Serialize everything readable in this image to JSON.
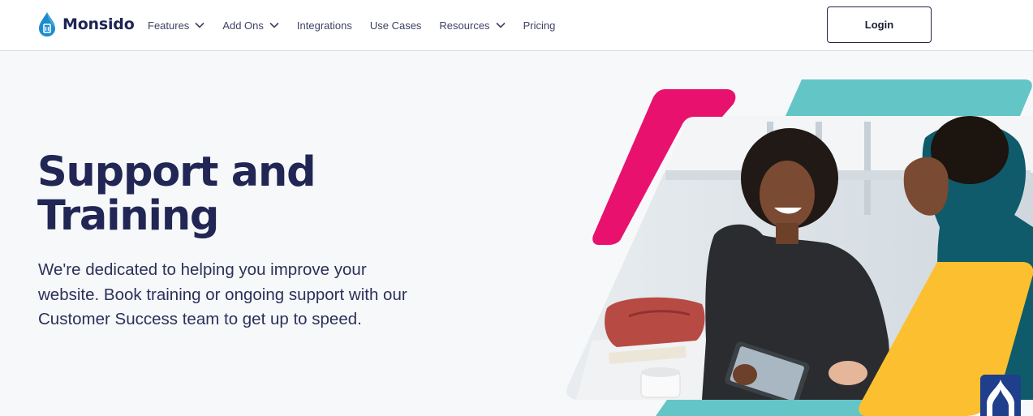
{
  "brand": {
    "name": "Monsido",
    "color": "#1e2454",
    "logo_icon": "monsido-droplet-logo"
  },
  "nav": {
    "items": [
      {
        "label": "Features",
        "has_dropdown": true
      },
      {
        "label": "Add Ons",
        "has_dropdown": true
      },
      {
        "label": "Integrations",
        "has_dropdown": false
      },
      {
        "label": "Use Cases",
        "has_dropdown": false
      },
      {
        "label": "Resources",
        "has_dropdown": true
      },
      {
        "label": "Pricing",
        "has_dropdown": false
      }
    ],
    "dropdown_icon": "chevron-down-icon",
    "login_label": "Login"
  },
  "hero": {
    "title_line1": "Support and",
    "title_line2": "Training",
    "description": "We're dedicated to helping you improve your website. Book training or ongoing support with our Customer Success team to get up to speed.",
    "image": "two people smiling while looking at a tablet in an office, framed by pink, teal and yellow parallelogram shapes"
  },
  "colors": {
    "pink_accent": "#e8126e",
    "teal_accent": "#64c5c6",
    "yellow_accent": "#fcbf30",
    "navy_text": "#212654",
    "page_background": "#f7f8fa"
  },
  "chat_widget": {
    "icon": "chat-widget-icon"
  }
}
